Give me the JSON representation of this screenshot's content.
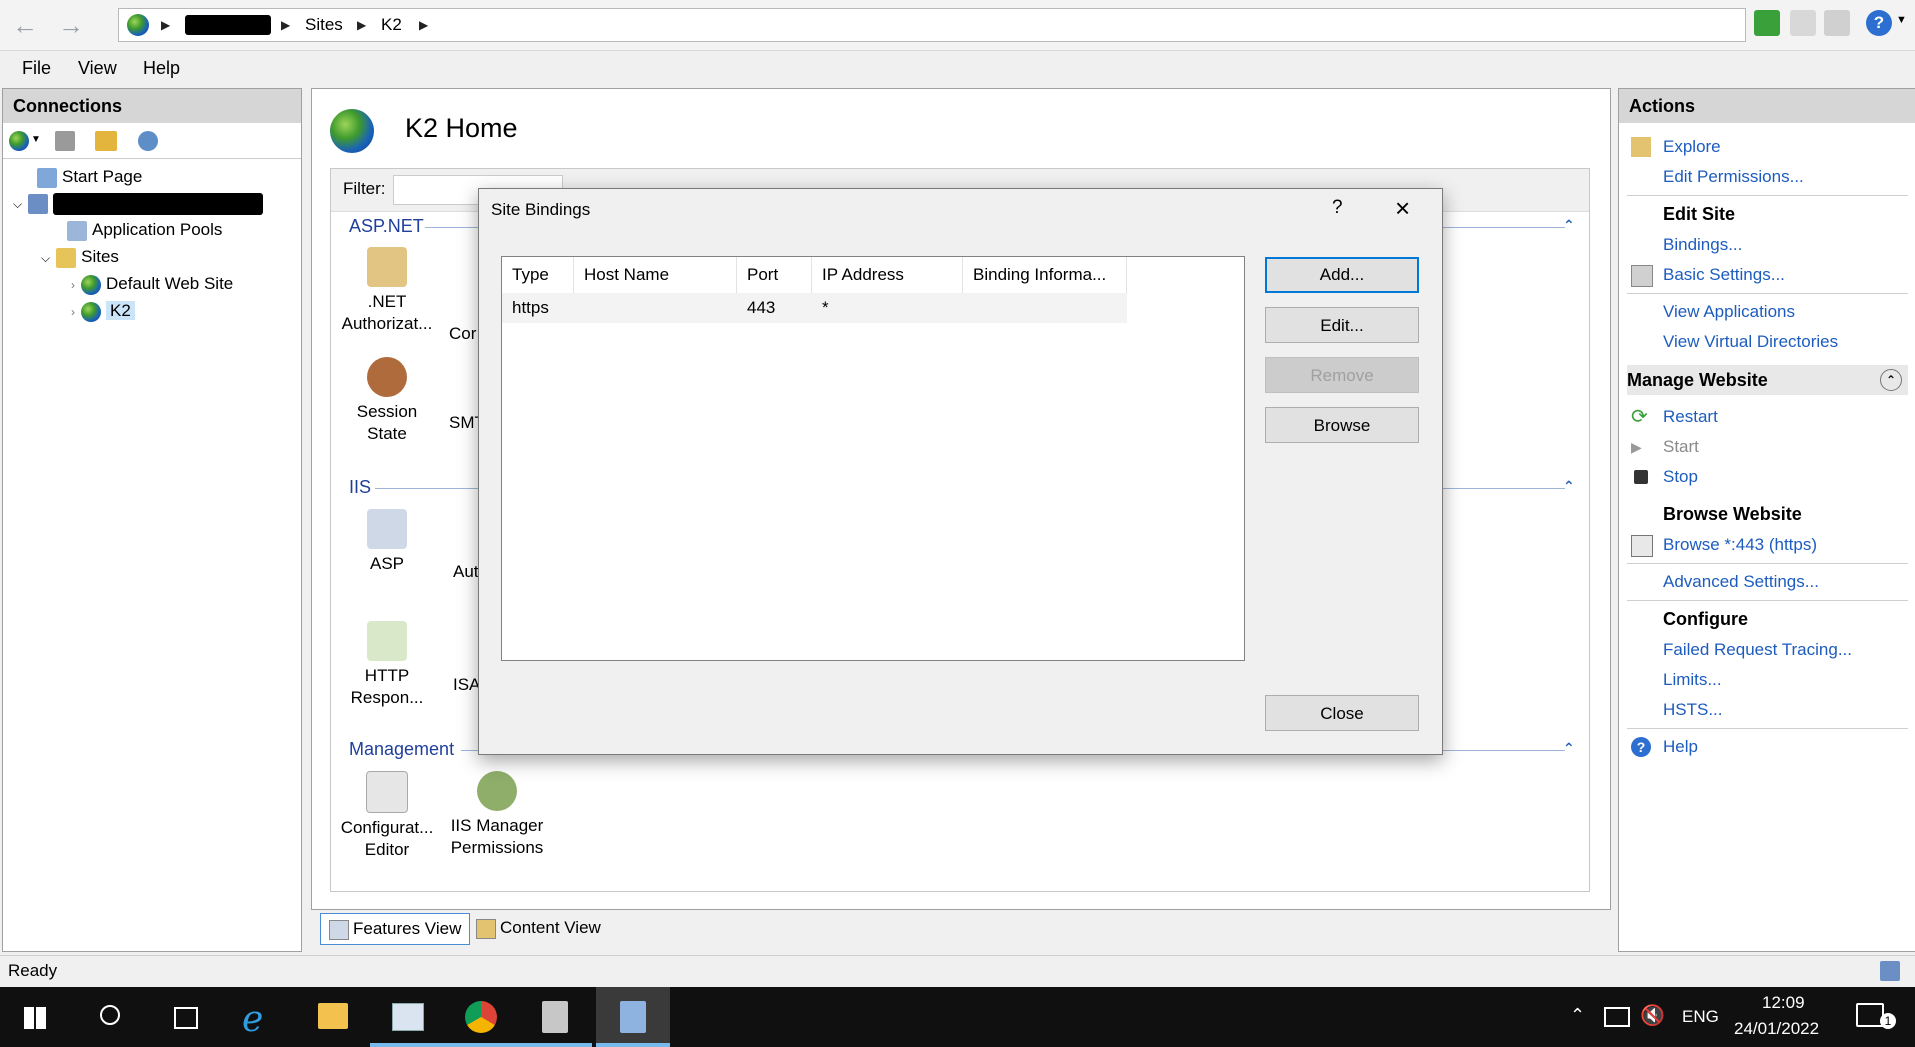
{
  "address": {
    "crumbs": [
      "Sites",
      "K2"
    ]
  },
  "menu": [
    "File",
    "View",
    "Help"
  ],
  "connections": {
    "title": "Connections",
    "tree": {
      "start_page": "Start Page",
      "app_pools": "Application Pools",
      "sites": "Sites",
      "default_site": "Default Web Site",
      "k2": "K2"
    }
  },
  "center": {
    "title": "K2 Home",
    "filter_label": "Filter:",
    "groups": {
      "aspnet": "ASP.NET",
      "iis": "IIS",
      "management": "Management"
    },
    "features": {
      "net_auth": ".NET\nAuthorizat...",
      "net_auth_1": ".NET",
      "net_auth_2": "Authorizat...",
      "com_partial": "Cor",
      "session_state": "Session State",
      "smtp_partial": "SMT",
      "asp": "ASP",
      "auth_partial": "Aut",
      "http_1": "HTTP",
      "http_2": "Respon...",
      "isa_partial": "ISA",
      "config_1": "Configurat...",
      "config_2": "Editor",
      "iismgr_1": "IIS Manager",
      "iismgr_2": "Permissions"
    },
    "views": {
      "features": "Features View",
      "content": "Content View"
    }
  },
  "actions": {
    "title": "Actions",
    "explore": "Explore",
    "edit_permissions": "Edit Permissions...",
    "edit_site": "Edit Site",
    "bindings": "Bindings...",
    "basic_settings": "Basic Settings...",
    "view_applications": "View Applications",
    "view_virtual_dirs": "View Virtual Directories",
    "manage_website": "Manage Website",
    "restart": "Restart",
    "start": "Start",
    "stop": "Stop",
    "browse_website": "Browse Website",
    "browse_443": "Browse *:443 (https)",
    "advanced_settings": "Advanced Settings...",
    "configure": "Configure",
    "failed_request": "Failed Request Tracing...",
    "limits": "Limits...",
    "hsts": "HSTS...",
    "help": "Help"
  },
  "status": "Ready",
  "dialog": {
    "title": "Site Bindings",
    "help": "?",
    "columns": [
      "Type",
      "Host Name",
      "Port",
      "IP Address",
      "Binding Informa..."
    ],
    "rows": [
      {
        "type": "https",
        "host": "",
        "port": "443",
        "ip": "*",
        "info": ""
      }
    ],
    "buttons": {
      "add": "Add...",
      "edit": "Edit...",
      "remove": "Remove",
      "browse": "Browse",
      "close": "Close"
    }
  },
  "taskbar": {
    "lang": "ENG",
    "time": "12:09",
    "date": "24/01/2022",
    "notif_count": "1"
  },
  "colors": {
    "link": "#1d5cbf",
    "accent": "#0078d7",
    "group_header": "#1f3f9a"
  }
}
